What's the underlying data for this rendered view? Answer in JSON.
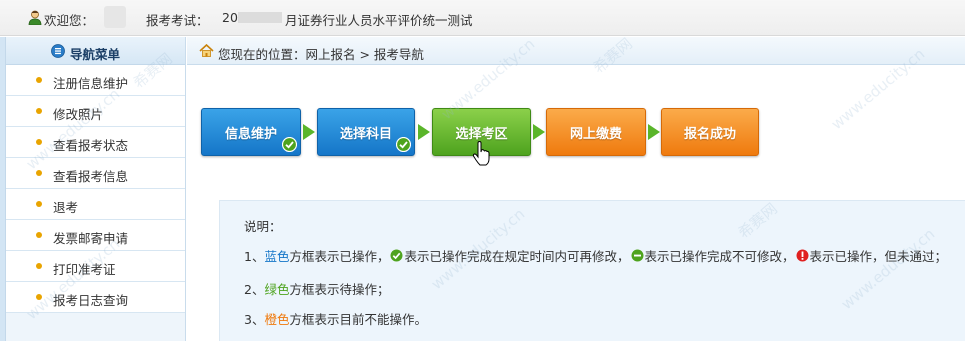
{
  "topbar": {
    "welcome": "欢迎您：",
    "exam_prefix": "报考考试：",
    "exam_date": "20",
    "exam_name": "月证券行业人员水平评价统一测试"
  },
  "sidebar": {
    "title": "导航菜单",
    "items": [
      {
        "label": "注册信息维护"
      },
      {
        "label": "修改照片"
      },
      {
        "label": "查看报考状态"
      },
      {
        "label": "查看报考信息"
      },
      {
        "label": "退考"
      },
      {
        "label": "发票邮寄申请"
      },
      {
        "label": "打印准考证"
      },
      {
        "label": "报考日志查询"
      }
    ]
  },
  "breadcrumb": {
    "text": "您现在的位置：网上报名  >  报考导航"
  },
  "steps": [
    {
      "label": "信息维护",
      "color": "blue",
      "completed": true
    },
    {
      "label": "选择科目",
      "color": "blue",
      "completed": true
    },
    {
      "label": "选择考区",
      "color": "green",
      "completed": false
    },
    {
      "label": "网上缴费",
      "color": "orange",
      "completed": false
    },
    {
      "label": "报名成功",
      "color": "orange",
      "completed": false
    }
  ],
  "notes": {
    "title": "说明：",
    "line1": {
      "num": "1、",
      "color_word": "蓝色",
      "text_a": "方框表示已操作，",
      "text_b": "表示已操作完成在规定时间内可再修改，",
      "text_c": "表示已操作完成不可修改，",
      "text_d": "表示已操作，但未通过；"
    },
    "line2": {
      "num": "2、",
      "color_word": "绿色",
      "text": "方框表示待操作；"
    },
    "line3": {
      "num": "3、",
      "color_word": "橙色",
      "text": "方框表示目前不能操作。"
    }
  },
  "watermark": {
    "text": "www.educity.cn",
    "brand": "希赛网"
  },
  "colors": {
    "blue": "#1576c8",
    "green": "#4ea31e",
    "orange": "#ef7a0e",
    "bullet": "#e9a400"
  }
}
